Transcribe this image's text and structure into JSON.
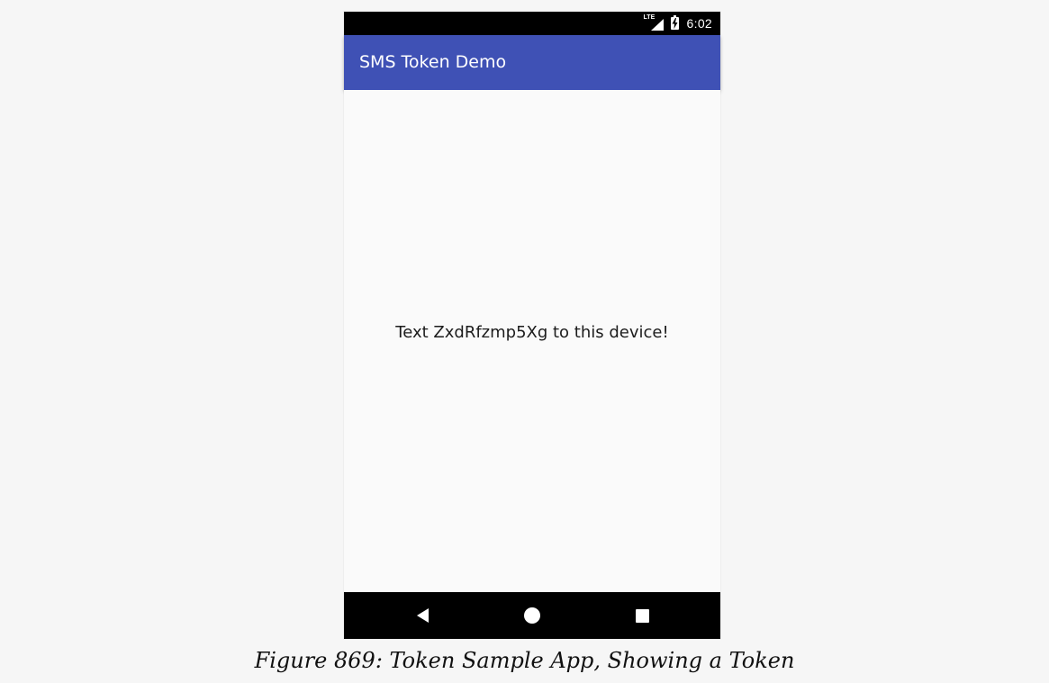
{
  "status_bar": {
    "network": "LTE",
    "time": "6:02",
    "icons": [
      "lte-signal-icon",
      "battery-charging-icon"
    ]
  },
  "app_bar": {
    "title": "SMS Token Demo",
    "color": "#3f51b5"
  },
  "content": {
    "message": "Text ZxdRfzmp5Xg to this device!"
  },
  "nav_bar": {
    "icons": [
      "back-icon",
      "home-icon",
      "recents-icon"
    ]
  },
  "caption": {
    "text": "Figure 869: Token Sample App, Showing a Token"
  }
}
